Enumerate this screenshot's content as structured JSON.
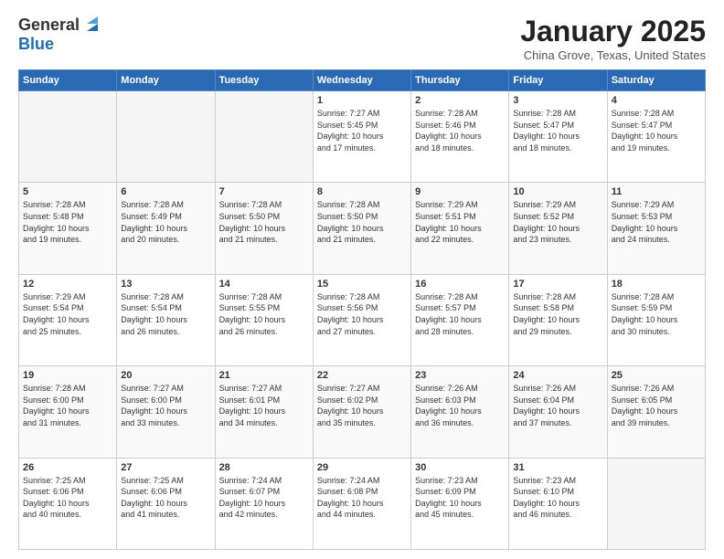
{
  "logo": {
    "general": "General",
    "blue": "Blue"
  },
  "header": {
    "title": "January 2025",
    "subtitle": "China Grove, Texas, United States"
  },
  "weekdays": [
    "Sunday",
    "Monday",
    "Tuesday",
    "Wednesday",
    "Thursday",
    "Friday",
    "Saturday"
  ],
  "weeks": [
    [
      {
        "day": "",
        "info": ""
      },
      {
        "day": "",
        "info": ""
      },
      {
        "day": "",
        "info": ""
      },
      {
        "day": "1",
        "info": "Sunrise: 7:27 AM\nSunset: 5:45 PM\nDaylight: 10 hours\nand 17 minutes."
      },
      {
        "day": "2",
        "info": "Sunrise: 7:28 AM\nSunset: 5:46 PM\nDaylight: 10 hours\nand 18 minutes."
      },
      {
        "day": "3",
        "info": "Sunrise: 7:28 AM\nSunset: 5:47 PM\nDaylight: 10 hours\nand 18 minutes."
      },
      {
        "day": "4",
        "info": "Sunrise: 7:28 AM\nSunset: 5:47 PM\nDaylight: 10 hours\nand 19 minutes."
      }
    ],
    [
      {
        "day": "5",
        "info": "Sunrise: 7:28 AM\nSunset: 5:48 PM\nDaylight: 10 hours\nand 19 minutes."
      },
      {
        "day": "6",
        "info": "Sunrise: 7:28 AM\nSunset: 5:49 PM\nDaylight: 10 hours\nand 20 minutes."
      },
      {
        "day": "7",
        "info": "Sunrise: 7:28 AM\nSunset: 5:50 PM\nDaylight: 10 hours\nand 21 minutes."
      },
      {
        "day": "8",
        "info": "Sunrise: 7:28 AM\nSunset: 5:50 PM\nDaylight: 10 hours\nand 21 minutes."
      },
      {
        "day": "9",
        "info": "Sunrise: 7:29 AM\nSunset: 5:51 PM\nDaylight: 10 hours\nand 22 minutes."
      },
      {
        "day": "10",
        "info": "Sunrise: 7:29 AM\nSunset: 5:52 PM\nDaylight: 10 hours\nand 23 minutes."
      },
      {
        "day": "11",
        "info": "Sunrise: 7:29 AM\nSunset: 5:53 PM\nDaylight: 10 hours\nand 24 minutes."
      }
    ],
    [
      {
        "day": "12",
        "info": "Sunrise: 7:29 AM\nSunset: 5:54 PM\nDaylight: 10 hours\nand 25 minutes."
      },
      {
        "day": "13",
        "info": "Sunrise: 7:28 AM\nSunset: 5:54 PM\nDaylight: 10 hours\nand 26 minutes."
      },
      {
        "day": "14",
        "info": "Sunrise: 7:28 AM\nSunset: 5:55 PM\nDaylight: 10 hours\nand 26 minutes."
      },
      {
        "day": "15",
        "info": "Sunrise: 7:28 AM\nSunset: 5:56 PM\nDaylight: 10 hours\nand 27 minutes."
      },
      {
        "day": "16",
        "info": "Sunrise: 7:28 AM\nSunset: 5:57 PM\nDaylight: 10 hours\nand 28 minutes."
      },
      {
        "day": "17",
        "info": "Sunrise: 7:28 AM\nSunset: 5:58 PM\nDaylight: 10 hours\nand 29 minutes."
      },
      {
        "day": "18",
        "info": "Sunrise: 7:28 AM\nSunset: 5:59 PM\nDaylight: 10 hours\nand 30 minutes."
      }
    ],
    [
      {
        "day": "19",
        "info": "Sunrise: 7:28 AM\nSunset: 6:00 PM\nDaylight: 10 hours\nand 31 minutes."
      },
      {
        "day": "20",
        "info": "Sunrise: 7:27 AM\nSunset: 6:00 PM\nDaylight: 10 hours\nand 33 minutes."
      },
      {
        "day": "21",
        "info": "Sunrise: 7:27 AM\nSunset: 6:01 PM\nDaylight: 10 hours\nand 34 minutes."
      },
      {
        "day": "22",
        "info": "Sunrise: 7:27 AM\nSunset: 6:02 PM\nDaylight: 10 hours\nand 35 minutes."
      },
      {
        "day": "23",
        "info": "Sunrise: 7:26 AM\nSunset: 6:03 PM\nDaylight: 10 hours\nand 36 minutes."
      },
      {
        "day": "24",
        "info": "Sunrise: 7:26 AM\nSunset: 6:04 PM\nDaylight: 10 hours\nand 37 minutes."
      },
      {
        "day": "25",
        "info": "Sunrise: 7:26 AM\nSunset: 6:05 PM\nDaylight: 10 hours\nand 39 minutes."
      }
    ],
    [
      {
        "day": "26",
        "info": "Sunrise: 7:25 AM\nSunset: 6:06 PM\nDaylight: 10 hours\nand 40 minutes."
      },
      {
        "day": "27",
        "info": "Sunrise: 7:25 AM\nSunset: 6:06 PM\nDaylight: 10 hours\nand 41 minutes."
      },
      {
        "day": "28",
        "info": "Sunrise: 7:24 AM\nSunset: 6:07 PM\nDaylight: 10 hours\nand 42 minutes."
      },
      {
        "day": "29",
        "info": "Sunrise: 7:24 AM\nSunset: 6:08 PM\nDaylight: 10 hours\nand 44 minutes."
      },
      {
        "day": "30",
        "info": "Sunrise: 7:23 AM\nSunset: 6:09 PM\nDaylight: 10 hours\nand 45 minutes."
      },
      {
        "day": "31",
        "info": "Sunrise: 7:23 AM\nSunset: 6:10 PM\nDaylight: 10 hours\nand 46 minutes."
      },
      {
        "day": "",
        "info": ""
      }
    ]
  ]
}
